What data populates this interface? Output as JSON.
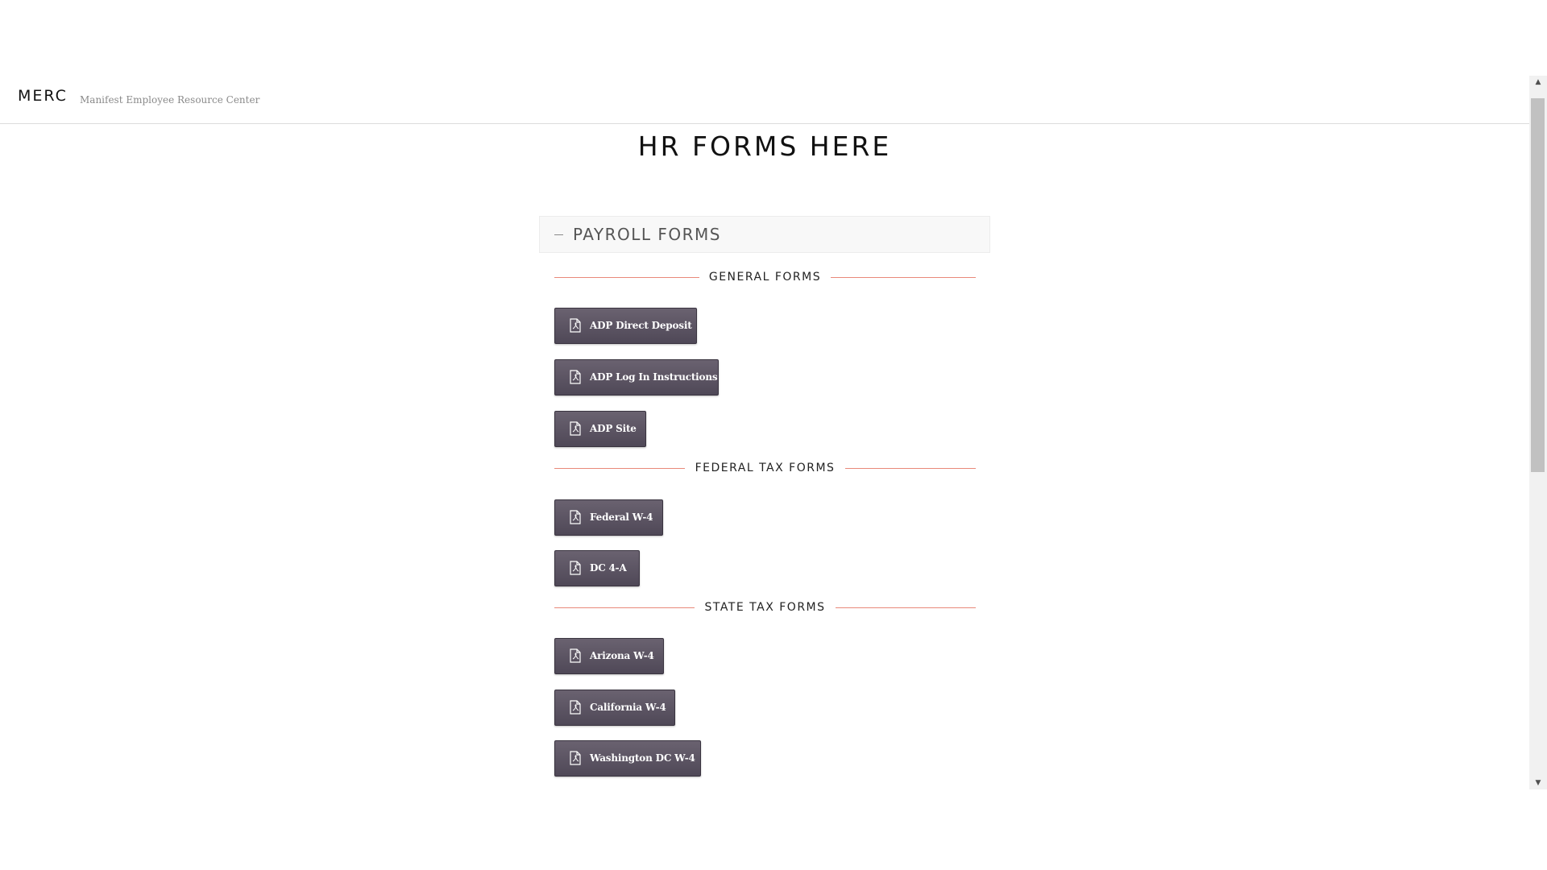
{
  "header": {
    "brand": "MERC",
    "tagline": "Manifest Employee Resource Center"
  },
  "page": {
    "title": "HR FORMS HERE"
  },
  "accordion": {
    "title": "PAYROLL FORMS",
    "expanded": true,
    "sections": [
      {
        "label": "GENERAL FORMS",
        "buttons": [
          "ADP Direct Deposit",
          "ADP Log In Instructions",
          "ADP Site"
        ]
      },
      {
        "label": "FEDERAL TAX FORMS",
        "buttons": [
          "Federal W-4",
          "DC 4-A"
        ]
      },
      {
        "label": "STATE TAX FORMS",
        "buttons": [
          "Arizona W-4",
          "California W-4",
          "Washington DC W-4"
        ]
      }
    ]
  },
  "icons": {
    "button_icon": "file-pdf-icon",
    "accordion_icon": "minus-icon"
  },
  "colors": {
    "button_bg": "#5a5261",
    "divider_line": "#e9897a",
    "text": "#111111"
  }
}
